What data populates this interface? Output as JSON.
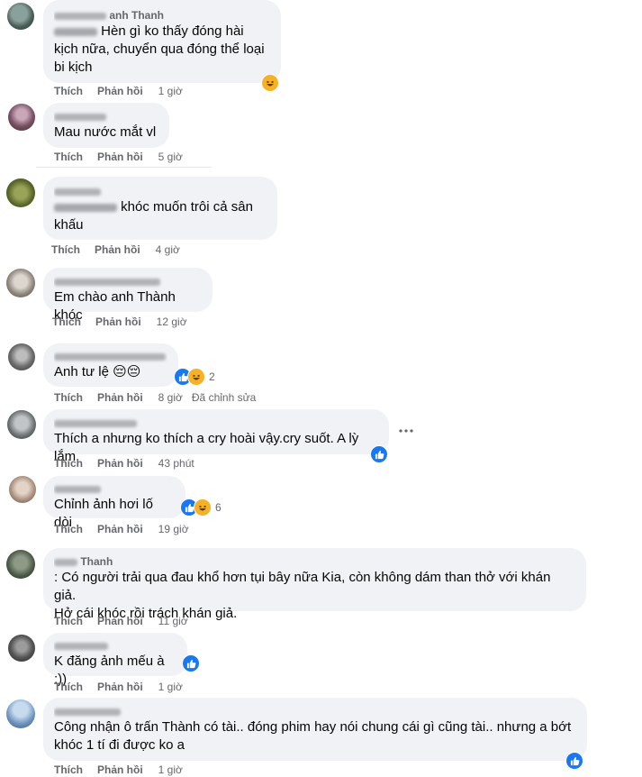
{
  "actions": {
    "like": "Thích",
    "reply": "Phản hồi"
  },
  "comments": [
    {
      "author": "Nguyễn Thanh",
      "author_suffix": "anh Thanh",
      "text": "Hèn gì ko thấy đóng hài\nkịch nữa, chuyển qua đóng thể loại\nbi kịch",
      "time": "1 giờ",
      "reaction_count": ""
    },
    {
      "author": "",
      "text": "Mau nước mắt vl",
      "time": "5 giờ"
    },
    {
      "author": "Phan Vũ",
      "text": "khóc muốn trôi cả sân\nkhấu",
      "time": "4 giờ"
    },
    {
      "author": "Huỳnh Thanh Linh",
      "text": "Em chào anh Thành khóc",
      "time": "12 giờ"
    },
    {
      "author": "",
      "text": "Anh tư lệ 😔😔",
      "time": "8 giờ",
      "edited": "Đã chỉnh sửa",
      "reaction_count": "2"
    },
    {
      "author": "",
      "text": "Thích a nhưng ko thích a cry hoài vậy.cry suốt. A lỳ lắm",
      "time": "43 phút"
    },
    {
      "author": "Kim Hoa",
      "text": "Chỉnh ảnh hơi lố dòi",
      "time": "19 giờ",
      "reaction_count": "6"
    },
    {
      "author": "Thanh",
      "text": ": Có người trải qua đau khổ hơn tụi bây nữa Kia, còn không dám than thở với khán giả.\nHở cái khóc rồi trách khán giả.",
      "time": "11 giờ"
    },
    {
      "author": "",
      "text": "K đăng ảnh mếu à :))",
      "time": "1 giờ"
    },
    {
      "author": "Linh Nguyen",
      "text": "Công nhận ô trấn Thành có tài.. đóng phim hay nói chung cái gì cũng tài.. nhưng a bớt\nkhóc 1 tí đi được ko a",
      "time": "1 giờ"
    }
  ],
  "colors": {
    "bubble": "#f0f2f5",
    "meta": "#65676b",
    "text": "#050505",
    "like_blue": "#1877f2",
    "haha_yellow": "#f7b125"
  },
  "icons": {
    "like": "thumbs-up-icon",
    "haha": "haha-emoji-icon",
    "more": "more-options-icon"
  }
}
